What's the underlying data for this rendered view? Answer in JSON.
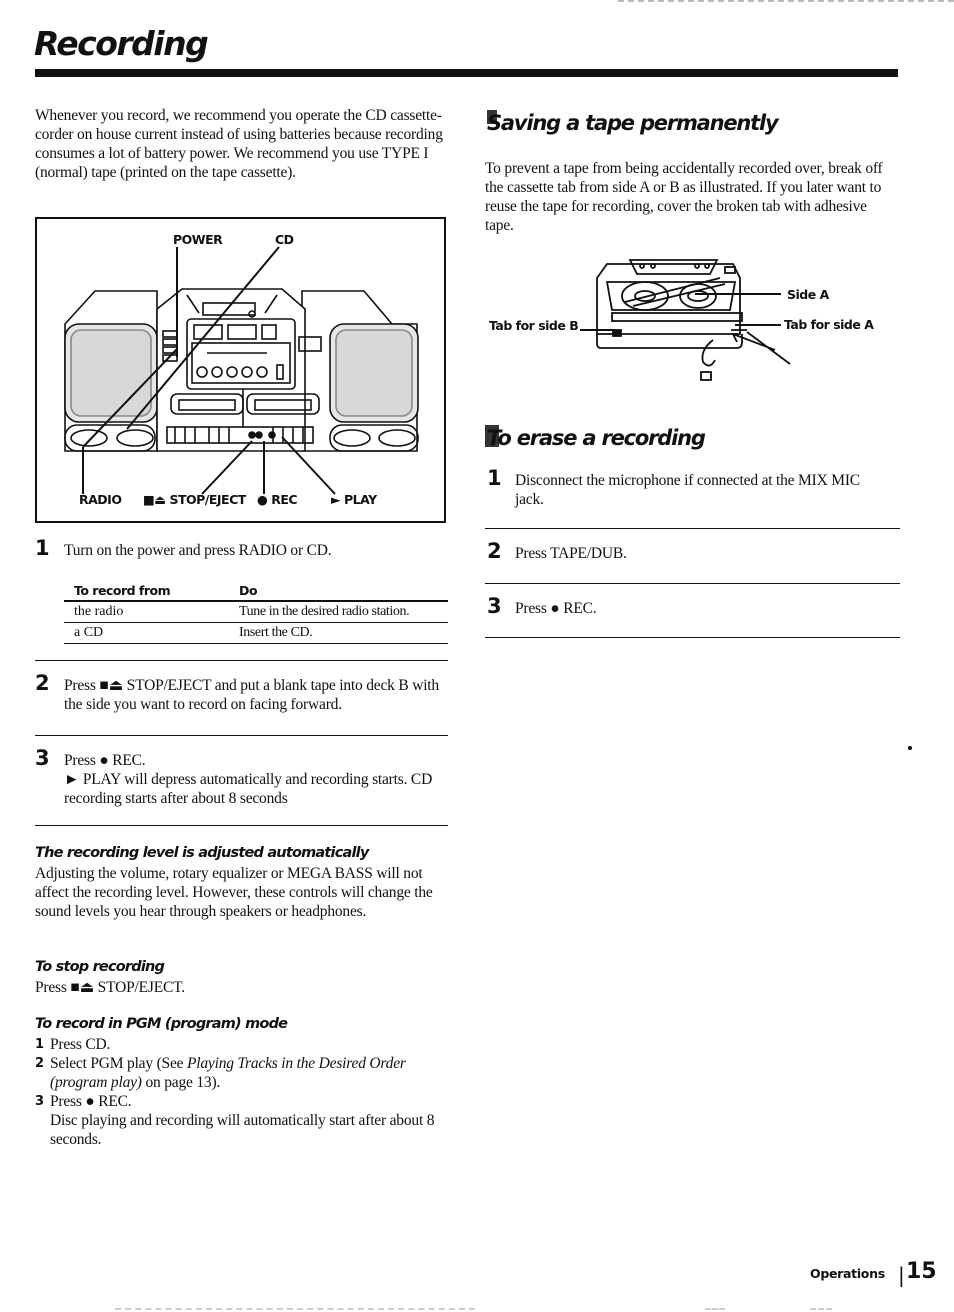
{
  "page": {
    "title": "Recording",
    "intro": "Whenever you record, we recommend you operate the CD cassette-corder on house current instead of using batteries because recording consumes a lot of battery power. We recommend you use TYPE I (normal) tape (printed on the tape cassette).",
    "footer": {
      "section": "Operations",
      "page_number": "15"
    }
  },
  "boombox_figure": {
    "labels": {
      "power": "POWER",
      "cd": "CD",
      "radio": "RADIO",
      "stop_eject": "■⏏ STOP/EJECT",
      "rec": "● REC",
      "play": "► PLAY"
    }
  },
  "record_steps": [
    {
      "number": "1",
      "text": "Turn on the power and press RADIO or CD."
    },
    {
      "number": "2",
      "text": "Press ■⏏ STOP/EJECT and put a blank tape into deck B with the side you want to record on facing forward."
    },
    {
      "number": "3",
      "text": "Press ● REC.",
      "detail": "► PLAY will depress automatically and recording starts. CD recording starts after about 8 seconds"
    }
  ],
  "source_table": {
    "headers": [
      "To record from",
      "Do"
    ],
    "rows": [
      [
        "the radio",
        "Tune in the desired radio station."
      ],
      [
        "a CD",
        "Insert the CD."
      ]
    ]
  },
  "notes": {
    "auto_level": {
      "heading": "The recording level is adjusted automatically",
      "text": "Adjusting the volume, rotary equalizer or MEGA BASS will not affect the recording level. However, these controls will change the sound levels you hear through speakers or headphones."
    },
    "stop": {
      "heading": "To stop recording",
      "text": "Press ■⏏ STOP/EJECT."
    },
    "pgm": {
      "heading": "To record in PGM (program) mode",
      "items": [
        {
          "number": "1",
          "text": "Press CD."
        },
        {
          "number": "2",
          "text_before": "Select PGM play (See ",
          "italic": "Playing Tracks in the Desired Order (program play)",
          "text_after": " on page 13)."
        },
        {
          "number": "3",
          "text": "Press ● REC.",
          "detail": "Disc playing and recording will automatically start after about 8 seconds."
        }
      ]
    }
  },
  "saving_section": {
    "heading": "Saving a tape permanently",
    "text": "To prevent a tape from being accidentally recorded over, break off the cassette tab from side A or B as illustrated. If you later want to reuse the tape for recording, cover the broken tab with adhesive tape.",
    "figure_labels": {
      "side_a": "Side A",
      "tab_side_b": "Tab for side B",
      "tab_side_a": "Tab for side A"
    }
  },
  "erase_section": {
    "heading": "To erase a recording",
    "steps": [
      {
        "number": "1",
        "text": "Disconnect the microphone if connected at the MIX MIC jack."
      },
      {
        "number": "2",
        "text": "Press TAPE/DUB."
      },
      {
        "number": "3",
        "text": "Press ● REC."
      }
    ]
  }
}
